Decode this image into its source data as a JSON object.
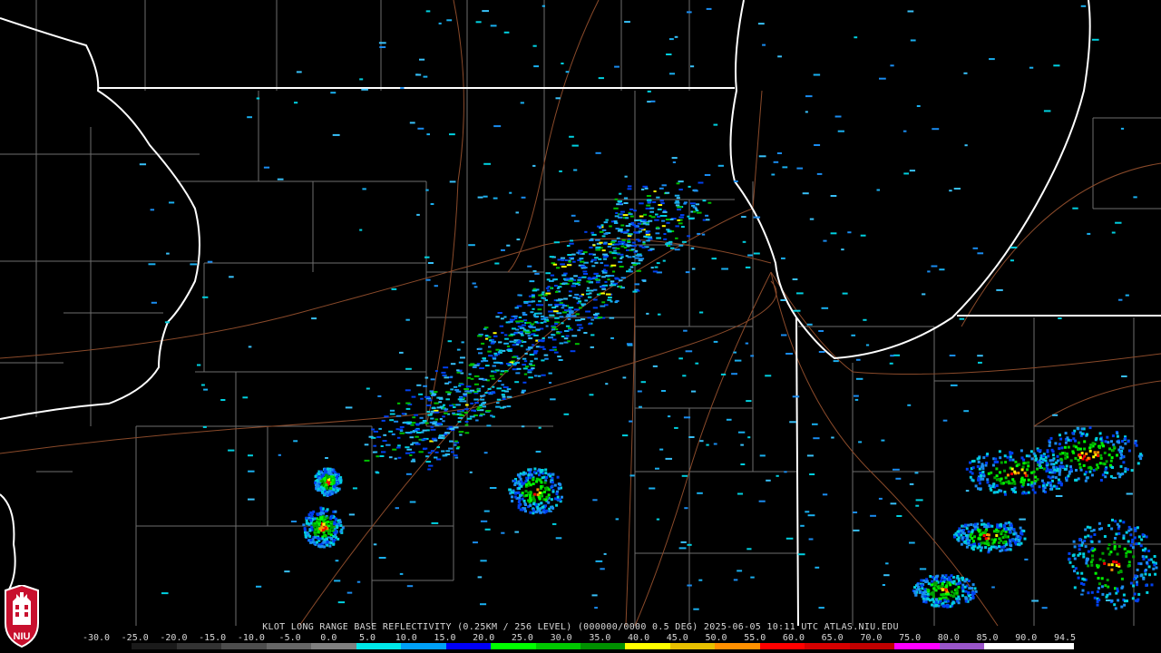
{
  "product_caption": "KLOT LONG RANGE BASE REFLECTIVITY (0.25KM / 256 LEVEL) (000000/0000 0.5 DEG) 2025-06-05 10:11 UTC  ATLAS.NIU.EDU",
  "scale": {
    "labels": [
      "-30.0",
      "-25.0",
      "-20.0",
      "-15.0",
      "-10.0",
      "-5.0",
      "0.0",
      "5.0",
      "10.0",
      "15.0",
      "20.0",
      "25.0",
      "30.0",
      "35.0",
      "40.0",
      "45.0",
      "50.0",
      "55.0",
      "60.0",
      "65.0",
      "70.0",
      "75.0",
      "80.0",
      "85.0",
      "90.0",
      "94.5"
    ],
    "colors": [
      "#000000",
      "#1a1a1a",
      "#333333",
      "#4d4d4d",
      "#666666",
      "#808080",
      "#00e8e8",
      "#00a0f6",
      "#0000f6",
      "#00ff00",
      "#00c800",
      "#009000",
      "#ffff00",
      "#e7c000",
      "#ff9000",
      "#ff0000",
      "#d60000",
      "#c00000",
      "#ff00ff",
      "#9955c9",
      "#ffffff",
      "#ffffff"
    ]
  },
  "logo_text": "NIU"
}
